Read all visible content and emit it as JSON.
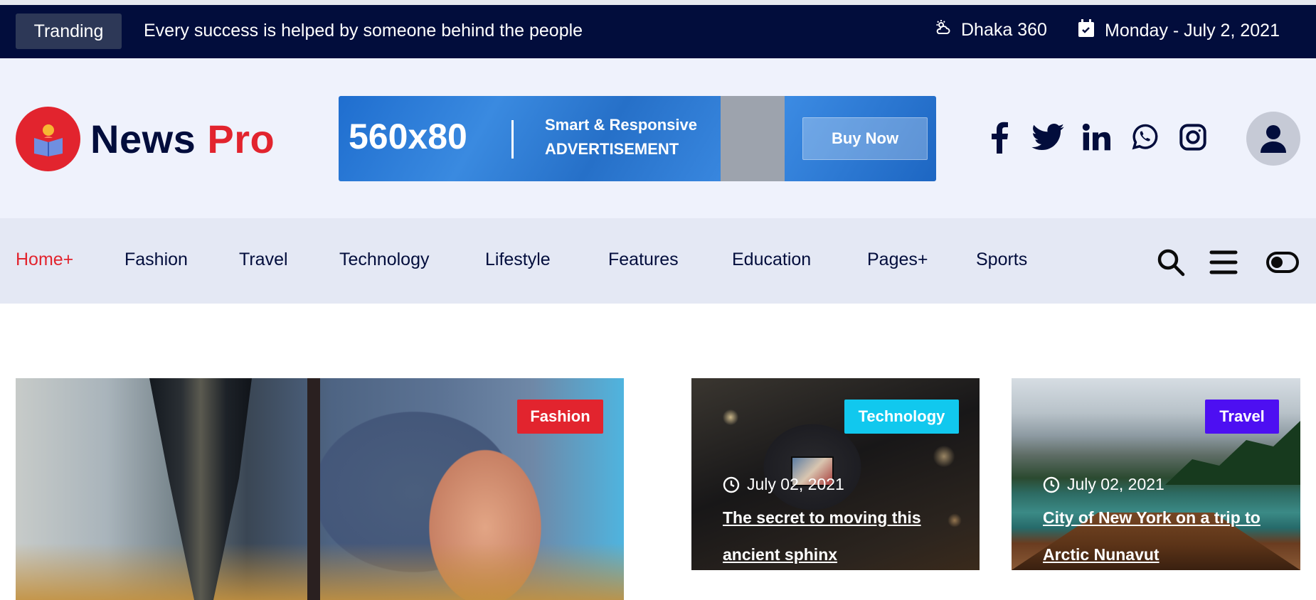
{
  "topbar": {
    "trending_label": "Tranding",
    "trending_text": "Every success is helped by someone behind the people",
    "weather": "Dhaka 360",
    "date": "Monday - July 2, 2021"
  },
  "header": {
    "logo_word1": "News",
    "logo_word2": "Pro",
    "ad": {
      "size": "560x80",
      "line1": "Smart & Responsive",
      "line2": "ADVERTISEMENT",
      "button": "Buy Now"
    },
    "socials": [
      "facebook-icon",
      "twitter-icon",
      "linkedin-icon",
      "whatsapp-icon",
      "instagram-icon"
    ]
  },
  "nav": {
    "items": [
      "Home+",
      "Fashion",
      "Travel",
      "Technology",
      "Lifestyle",
      "Features",
      "Education",
      "Pages+",
      "Sports"
    ],
    "active_index": 0
  },
  "cards": [
    {
      "tag": "Fashion",
      "tag_color": "#e2242e"
    },
    {
      "tag": "Technology",
      "tag_color": "#11c8ee",
      "date": "July 02, 2021",
      "title": "The secret to moving this ancient sphinx"
    },
    {
      "tag": "Travel",
      "tag_color": "#4d0ff2",
      "date": "July 02, 2021",
      "title": "City of New York on a trip to Arctic Nunavut"
    }
  ],
  "colors": {
    "brand_dark": "#020d3c",
    "brand_red": "#e2242e",
    "header_bg": "#eff2fc",
    "nav_bg": "#e4e8f4"
  }
}
